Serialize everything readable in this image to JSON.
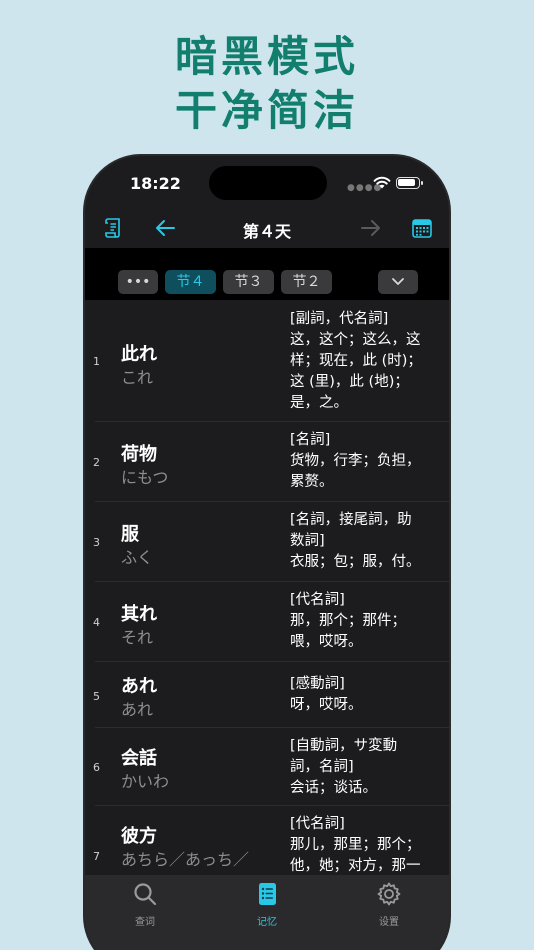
{
  "promo": {
    "line1": "暗黑模式",
    "line2": "干净简洁"
  },
  "status": {
    "time": "18:22"
  },
  "navbar": {
    "title": "第４天"
  },
  "chips": {
    "more": "•••",
    "items": [
      "节４",
      "节３",
      "节２"
    ]
  },
  "words": [
    {
      "num": "1",
      "word": "此れ",
      "reading": "これ",
      "meaning": [
        "[副詞，代名詞]",
        "这，这个；这么，这",
        "样；现在，此 (时)；",
        "这 (里)，此 (地)；",
        "是，之。"
      ]
    },
    {
      "num": "2",
      "word": "荷物",
      "reading": "にもつ",
      "meaning": [
        "[名詞]",
        "货物，行李；负担，",
        "累赘。"
      ]
    },
    {
      "num": "3",
      "word": "服",
      "reading": "ふく",
      "meaning": [
        "[名詞，接尾詞，助",
        "数詞]",
        "衣服；包；服，付。"
      ]
    },
    {
      "num": "4",
      "word": "其れ",
      "reading": "それ",
      "meaning": [
        "[代名詞]",
        "那，那个；那件；",
        "喂，哎呀。"
      ]
    },
    {
      "num": "5",
      "word": "あれ",
      "reading": "あれ",
      "meaning": [
        "[感動詞]",
        "呀，哎呀。"
      ]
    },
    {
      "num": "6",
      "word": "会話",
      "reading": "かいわ",
      "meaning": [
        "[自動詞，サ変動",
        "詞，名詞]",
        "会话；谈话。"
      ]
    },
    {
      "num": "7",
      "word": "彼方",
      "reading": "あちら／あっち／",
      "meaning": [
        "[代名詞]",
        "那儿，那里；那个；",
        "他，她；对方，那一"
      ]
    }
  ],
  "tabs": {
    "search": "查词",
    "memory": "记忆",
    "settings": "设置"
  },
  "colors": {
    "accent": "#29c8e6",
    "promo": "#127e6e",
    "background": "#cfe5ee"
  }
}
